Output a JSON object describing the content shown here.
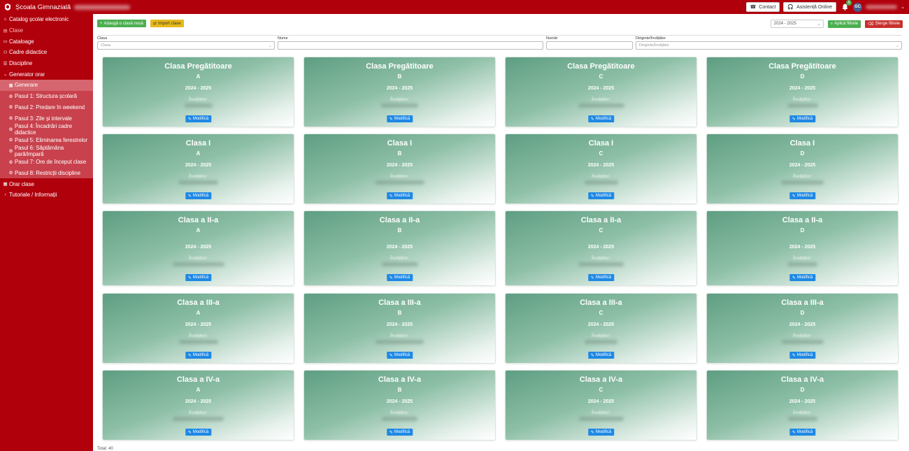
{
  "header": {
    "school_name": "Școala Gimnazială",
    "contact_label": "Contact",
    "assist_label": "Asistență Online",
    "notif_count": "6",
    "avatar_initials": "GC"
  },
  "sidebar": {
    "items": [
      {
        "label": "Catalog școlar electronic",
        "icon": "home-icon"
      },
      {
        "label": "Clase",
        "icon": "clipboard-icon"
      },
      {
        "label": "Cataloage",
        "icon": "book-icon"
      },
      {
        "label": "Cadre didactice",
        "icon": "users-icon"
      },
      {
        "label": "Discipline",
        "icon": "list-icon"
      },
      {
        "label": "Generator orar",
        "icon": "chevron-down-icon"
      }
    ],
    "sub_items": [
      {
        "label": "Generare",
        "icon": "calendar-icon"
      },
      {
        "label": "Pasul 1: Structura școlară",
        "icon": "gear-icon"
      },
      {
        "label": "Pasul 2: Predare în weekend",
        "icon": "gear-icon"
      },
      {
        "label": "Pasul 3: Zile și intervale",
        "icon": "gear-icon"
      },
      {
        "label": "Pasul 4: Încadrări cadre didactice",
        "icon": "gear-icon"
      },
      {
        "label": "Pasul 5: Eliminarea ferestrelor",
        "icon": "gear-icon"
      },
      {
        "label": "Pasul 6: Săptămâna pară/impară",
        "icon": "gear-icon"
      },
      {
        "label": "Pasul 7: Ore de început clase",
        "icon": "gear-icon"
      },
      {
        "label": "Pasul 8: Restricții discipline",
        "icon": "gear-icon"
      }
    ],
    "bottom_items": [
      {
        "label": "Orar clase",
        "icon": "calendar-icon"
      },
      {
        "label": "Tutoriale / Informații",
        "icon": "chevron-right-icon"
      }
    ]
  },
  "toolbar": {
    "add_label": "Adaugă o clasă nouă",
    "import_label": "Import clase",
    "year_value": "2024 - 2025",
    "apply_label": "Aplică filtrele",
    "clear_label": "Șterge filtrele"
  },
  "filters": {
    "clasa_label": "Clasa",
    "clasa_placeholder": "Clasa",
    "nume_label": "Nume",
    "numar_label": "Număr",
    "diriginte_label": "Diriginte/Învățător",
    "diriginte_placeholder": "Diriginte/Învățător"
  },
  "cards": [
    {
      "title": "Clasa Pregătitoare",
      "letter": "A",
      "year": "2024 - 2025",
      "teacher_label": "Învățător:",
      "button": "Modifică"
    },
    {
      "title": "Clasa Pregătitoare",
      "letter": "B",
      "year": "2024 - 2025",
      "teacher_label": "Învățător:",
      "button": "Modifică"
    },
    {
      "title": "Clasa Pregătitoare",
      "letter": "C",
      "year": "2024 - 2025",
      "teacher_label": "Învățător:",
      "button": "Modifică"
    },
    {
      "title": "Clasa Pregătitoare",
      "letter": "D",
      "year": "2024 - 2025",
      "teacher_label": "Învățător:",
      "button": "Modifică"
    },
    {
      "title": "Clasa I",
      "letter": "A",
      "year": "2024 - 2025",
      "teacher_label": "Învățător:",
      "button": "Modifică"
    },
    {
      "title": "Clasa I",
      "letter": "B",
      "year": "2024 - 2025",
      "teacher_label": "Învățător:",
      "button": "Modifică"
    },
    {
      "title": "Clasa I",
      "letter": "C",
      "year": "2024 - 2025",
      "teacher_label": "Învățător:",
      "button": "Modifică"
    },
    {
      "title": "Clasa I",
      "letter": "D",
      "year": "2024 - 2025",
      "teacher_label": "Învățător:",
      "button": "Modifică"
    },
    {
      "title": "Clasa a II-a",
      "letter": "A",
      "year": "2024 - 2025",
      "teacher_label": "Învățător:",
      "button": "Modifică"
    },
    {
      "title": "Clasa a II-a",
      "letter": "B",
      "year": "2024 - 2025",
      "teacher_label": "Învățător:",
      "button": "Modifică"
    },
    {
      "title": "Clasa a II-a",
      "letter": "C",
      "year": "2024 - 2025",
      "teacher_label": "Învățător:",
      "button": "Modifică"
    },
    {
      "title": "Clasa a II-a",
      "letter": "D",
      "year": "2024 - 2025",
      "teacher_label": "Învățător:",
      "button": "Modifică"
    },
    {
      "title": "Clasa a III-a",
      "letter": "A",
      "year": "2024 - 2025",
      "teacher_label": "Învățător:",
      "button": "Modifică"
    },
    {
      "title": "Clasa a III-a",
      "letter": "B",
      "year": "2024 - 2025",
      "teacher_label": "Învățător:",
      "button": "Modifică"
    },
    {
      "title": "Clasa a III-a",
      "letter": "C",
      "year": "2024 - 2025",
      "teacher_label": "Învățător:",
      "button": "Modifică"
    },
    {
      "title": "Clasa a III-a",
      "letter": "D",
      "year": "2024 - 2025",
      "teacher_label": "Învățător:",
      "button": "Modifică"
    },
    {
      "title": "Clasa a IV-a",
      "letter": "A",
      "year": "2024 - 2025",
      "teacher_label": "Învățător:",
      "button": "Modifică"
    },
    {
      "title": "Clasa a IV-a",
      "letter": "B",
      "year": "2024 - 2025",
      "teacher_label": "Învățător:",
      "button": "Modifică"
    },
    {
      "title": "Clasa a IV-a",
      "letter": "C",
      "year": "2024 - 2025",
      "teacher_label": "Învățător:",
      "button": "Modifică"
    },
    {
      "title": "Clasa a IV-a",
      "letter": "D",
      "year": "2024 - 2025",
      "teacher_label": "Învățător:",
      "button": "Modifică"
    }
  ],
  "footer": {
    "total_label": "Total: 40"
  },
  "colors": {
    "brand_red": "#b0000c",
    "card_green": "#5e9e82",
    "button_blue": "#1e88e5"
  }
}
